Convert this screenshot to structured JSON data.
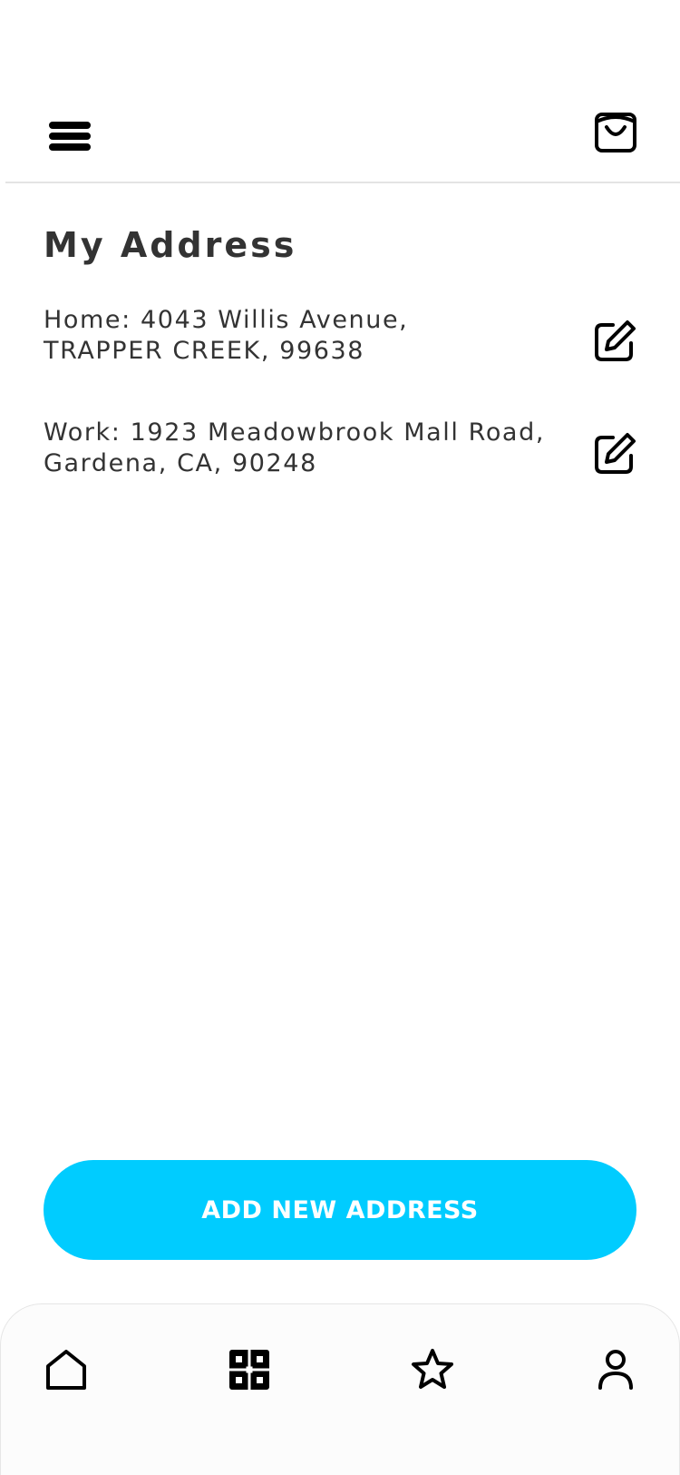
{
  "header": {
    "menu_icon": "hamburger-menu-icon",
    "cart_icon": "shopping-bag-icon"
  },
  "page": {
    "title": "My Address"
  },
  "addresses": [
    {
      "line1": "Home: 4043 Willis Avenue,",
      "line2": "TRAPPER CREEK, 99638",
      "edit_icon": "edit-icon"
    },
    {
      "line1": "Work: 1923 Meadowbrook Mall Road,",
      "line2": "Gardena, CA, 90248",
      "edit_icon": "edit-icon"
    }
  ],
  "add_button": {
    "label": "ADD NEW ADDRESS"
  },
  "bottom_nav": {
    "items": [
      {
        "icon": "home-icon",
        "active": false
      },
      {
        "icon": "categories-grid-icon",
        "active": true
      },
      {
        "icon": "star-icon",
        "active": false
      },
      {
        "icon": "profile-icon",
        "active": false
      }
    ]
  },
  "colors": {
    "accent": "#00ccff",
    "text": "#333333",
    "divider": "#e4e4e4",
    "icon": "#000000"
  }
}
